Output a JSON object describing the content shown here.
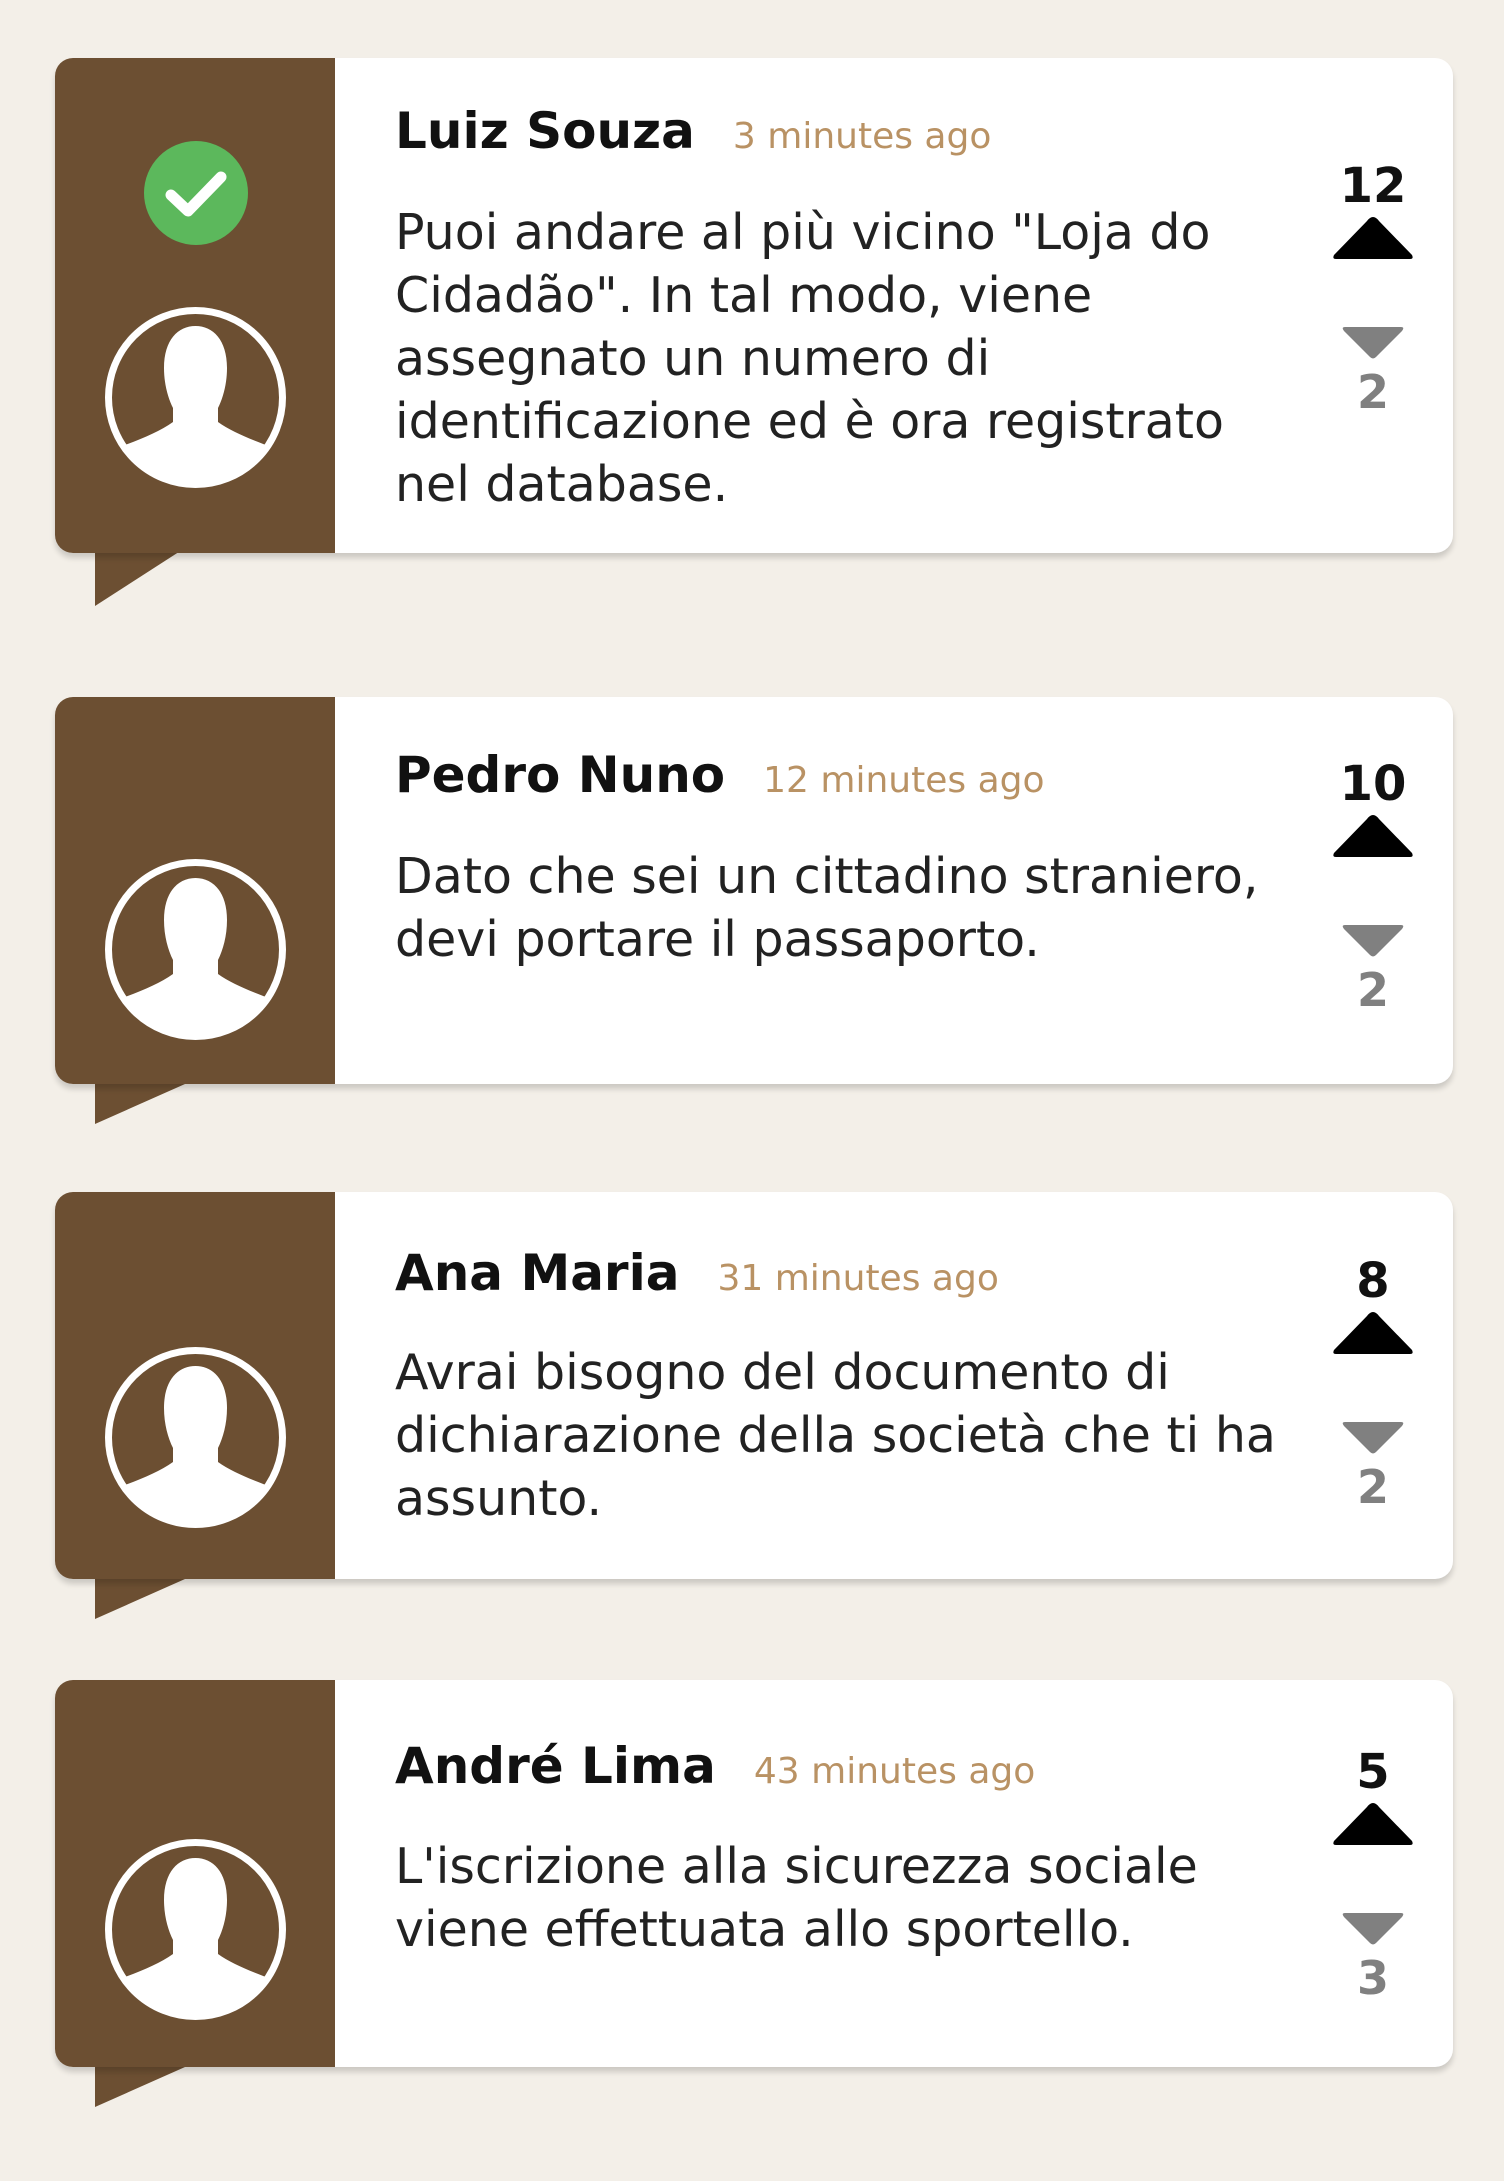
{
  "comments": [
    {
      "author": "Luiz Souza",
      "time": "3 minutes ago",
      "text": "Puoi andare al più vicino \"Loja do Cidadão\". In tal modo, viene assegnato un numero di identificazione ed è ora registrato nel database.",
      "upvotes": "12",
      "downvotes": "2",
      "accepted": true
    },
    {
      "author": "Pedro Nuno",
      "time": "12 minutes ago",
      "text": "Dato che sei un cittadino straniero, devi portare il passaporto.",
      "upvotes": "10",
      "downvotes": "2",
      "accepted": false
    },
    {
      "author": "Ana Maria",
      "time": "31 minutes ago",
      "text": "Avrai bisogno del documento di dichiarazione della società che ti ha assunto.",
      "upvotes": "8",
      "downvotes": "2",
      "accepted": false
    },
    {
      "author": "André Lima",
      "time": "43 minutes ago",
      "text": "L'iscrizione alla sicurezza sociale viene effettuata allo sportello.",
      "upvotes": "5",
      "downvotes": "3",
      "accepted": false
    }
  ],
  "icons": {
    "avatar": "user-avatar-icon",
    "accepted": "check-circle-icon",
    "upvote": "triangle-up-icon",
    "downvote": "triangle-down-icon"
  },
  "colors": {
    "page_background": "#f3efe8",
    "sidebar": "#6c4f32",
    "accepted": "#5cb85c",
    "timestamp": "#b99264",
    "downvote": "#808080"
  }
}
